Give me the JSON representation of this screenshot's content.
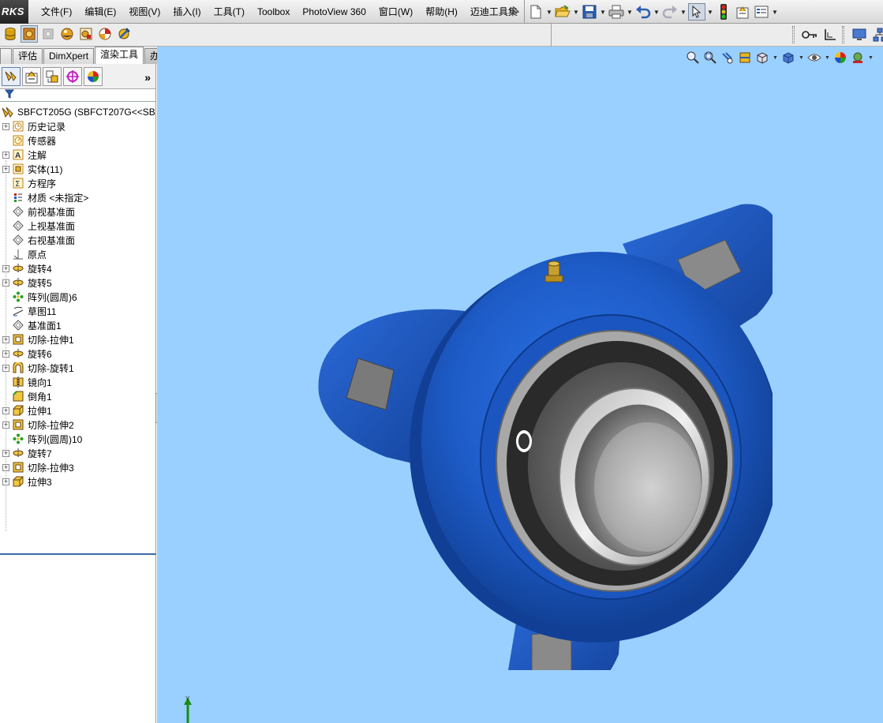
{
  "app": {
    "logo_text": "RKS"
  },
  "menu": [
    "文件(F)",
    "编辑(E)",
    "视图(V)",
    "插入(I)",
    "工具(T)",
    "Toolbox",
    "PhotoView 360",
    "窗口(W)",
    "帮助(H)",
    "迈迪工具集"
  ],
  "std_toolbar_icons": [
    "new-document-icon",
    "open-folder-icon",
    "save-icon",
    "print-icon",
    "undo-icon",
    "redo-icon",
    "select-pointer-icon",
    "traffic-light-icon",
    "options-icon",
    "customize-icon"
  ],
  "tabs": [
    "",
    "评估",
    "DimXpert",
    "渲染工具",
    "办公室产品"
  ],
  "active_tab_index": 3,
  "panel_tabs": [
    "feature-manager-icon",
    "property-manager-icon",
    "configuration-manager-icon",
    "dimxpert-manager-icon",
    "display-manager-icon"
  ],
  "panel_more": "»",
  "tree": {
    "root": "SBFCT205G  (SBFCT207G<<SB",
    "items": [
      {
        "label": "历史记录",
        "icon": "history-icon",
        "expandable": true
      },
      {
        "label": "传感器",
        "icon": "sensor-icon",
        "expandable": false
      },
      {
        "label": "注解",
        "icon": "annotation-icon",
        "expandable": true
      },
      {
        "label": "实体(11)",
        "icon": "solid-bodies-icon",
        "expandable": true
      },
      {
        "label": "方程序",
        "icon": "equations-icon",
        "expandable": false
      },
      {
        "label": "材质 <未指定>",
        "icon": "material-icon",
        "expandable": false
      },
      {
        "label": "前视基准面",
        "icon": "plane-icon",
        "expandable": false
      },
      {
        "label": "上视基准面",
        "icon": "plane-icon",
        "expandable": false
      },
      {
        "label": "右视基准面",
        "icon": "plane-icon",
        "expandable": false
      },
      {
        "label": "原点",
        "icon": "origin-icon",
        "expandable": false
      },
      {
        "label": "旋转4",
        "icon": "revolve-icon",
        "expandable": true
      },
      {
        "label": "旋转5",
        "icon": "revolve-icon",
        "expandable": true
      },
      {
        "label": "阵列(圆周)6",
        "icon": "circular-pattern-icon",
        "expandable": false
      },
      {
        "label": "草图11",
        "icon": "sketch-icon",
        "expandable": false
      },
      {
        "label": "基准面1",
        "icon": "plane-icon",
        "expandable": false
      },
      {
        "label": "切除-拉伸1",
        "icon": "cut-extrude-icon",
        "expandable": true
      },
      {
        "label": "旋转6",
        "icon": "revolve-icon",
        "expandable": true
      },
      {
        "label": "切除-旋转1",
        "icon": "cut-revolve-icon",
        "expandable": true
      },
      {
        "label": "镜向1",
        "icon": "mirror-icon",
        "expandable": false
      },
      {
        "label": "倒角1",
        "icon": "chamfer-icon",
        "expandable": false
      },
      {
        "label": "拉伸1",
        "icon": "extrude-icon",
        "expandable": true
      },
      {
        "label": "切除-拉伸2",
        "icon": "cut-extrude-icon",
        "expandable": true
      },
      {
        "label": "阵列(圆周)10",
        "icon": "circular-pattern-icon",
        "expandable": false
      },
      {
        "label": "旋转7",
        "icon": "revolve-icon",
        "expandable": true
      },
      {
        "label": "切除-拉伸3",
        "icon": "cut-extrude-icon",
        "expandable": true
      },
      {
        "label": "拉伸3",
        "icon": "extrude-icon",
        "expandable": true
      }
    ]
  },
  "viewport": {
    "background": "#9ad0ff",
    "model": "three-bolt-flange-bearing-unit",
    "triad_label": "Y"
  },
  "colors": {
    "housing_blue": "#1e5cc8",
    "viewport_bg": "#9ad0ff",
    "active_tab_border": "#3a6aa8"
  }
}
